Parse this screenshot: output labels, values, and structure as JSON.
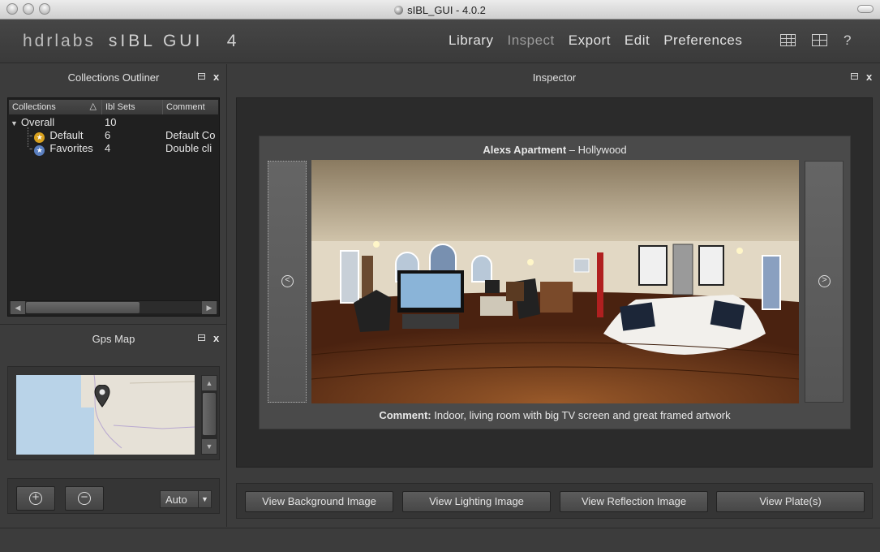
{
  "window": {
    "title": "sIBL_GUI - 4.0.2"
  },
  "header": {
    "logo_brand": "hdrlabs",
    "logo_app": "sIBL GUI   4",
    "nav": [
      "Library",
      "Inspect",
      "Export",
      "Edit",
      "Preferences"
    ],
    "active_nav": "Inspect",
    "help_label": "?"
  },
  "collections_outliner": {
    "title": "Collections Outliner",
    "columns": [
      "Collections",
      "Ibl Sets",
      "Comment"
    ],
    "rows": [
      {
        "name": "Overall",
        "count": "10",
        "comment": ""
      },
      {
        "name": "Default",
        "count": "6",
        "comment": "Default Co"
      },
      {
        "name": "Favorites",
        "count": "4",
        "comment": "Double cli"
      }
    ]
  },
  "gps_map": {
    "title": "Gps Map",
    "zoom": "Auto",
    "zoom_in_label": "+",
    "zoom_out_label": "−"
  },
  "inspector": {
    "title": "Inspector",
    "set_title": "Alexs Apartment",
    "set_location": "Hollywood",
    "comment_label": "Comment:",
    "comment_text": "Indoor, living room with big TV screen and great framed artwork",
    "prev_label": "<",
    "next_label": ">",
    "buttons": [
      "View Background Image",
      "View Lighting Image",
      "View Reflection Image",
      "View Plate(s)"
    ]
  },
  "colors": {
    "panel_bg": "#3c3c3c",
    "dark_bg": "#202020",
    "text": "#e0e0e0",
    "muted_nav": "#9b9b9b"
  }
}
